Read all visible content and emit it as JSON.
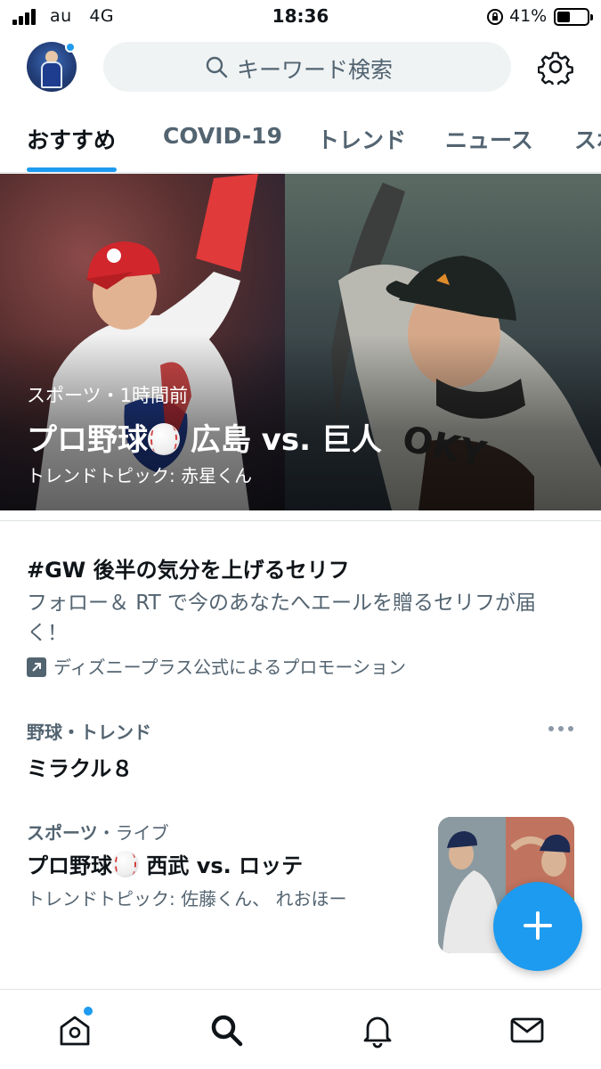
{
  "status_bar": {
    "carrier": "au",
    "network": "4G",
    "time": "18:36",
    "battery_percent": "41%",
    "battery_level": 0.41
  },
  "header": {
    "search_placeholder": "キーワード検索",
    "icons": [
      "avatar",
      "search-icon",
      "gear-icon"
    ]
  },
  "tabs": [
    {
      "label": "おすすめ",
      "active": true
    },
    {
      "label": "COVID-19",
      "active": false
    },
    {
      "label": "トレンド",
      "active": false
    },
    {
      "label": "ニュース",
      "active": false
    },
    {
      "label": "スポ",
      "active": false
    }
  ],
  "hero": {
    "category": "スポーツ",
    "time": "・1時間前",
    "title_pre": "プロ野球",
    "title_post": " 広島 vs. 巨人",
    "topic": "トレンドトピック: 赤星くん"
  },
  "promoted": {
    "title": "#GW 後半の気分を上げるセリフ",
    "description": "フォロー＆ RT で今のあなたへエールを贈るセリフが届く！",
    "by": "ディズニープラス公式によるプロモーション"
  },
  "trend_1": {
    "meta": "野球・トレンド",
    "name": "ミラクル８"
  },
  "trend_2": {
    "category": "スポーツ",
    "status": "・ライブ",
    "title_pre": "プロ野球",
    "title_post": " 西武 vs. ロッテ",
    "topic": "トレンドトピック: 佐藤くん、 れおほー"
  },
  "bottom_nav": [
    "home-icon",
    "search-icon",
    "notifications-icon",
    "messages-icon"
  ],
  "colors": {
    "accent": "#1d9bf0",
    "text": "#0f1419",
    "secondary": "#536471"
  }
}
